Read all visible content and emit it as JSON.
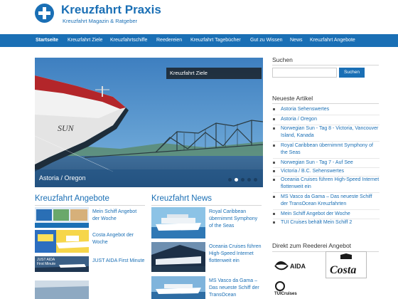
{
  "header": {
    "title": "Kreuzfahrt Praxis",
    "tagline": "Kreuzfahrt Magazin & Ratgeber"
  },
  "nav": {
    "items": [
      "Startseite",
      "Kreuzfahrt Ziele",
      "Kreuzfahrtschiffe",
      "Reedereien",
      "Kreuzfahrt Tagebücher",
      "Gut zu Wissen",
      "News",
      "Kreuzfahrt Angebote"
    ],
    "active_index": 0
  },
  "slider": {
    "tag": "Kreuzfahrt Ziele",
    "caption": "Astoria / Oregon",
    "ship_name": "SUN",
    "dots": 5,
    "active_dot": 1
  },
  "angebote": {
    "title": "Kreuzfahrt Angebote",
    "items": [
      "Mein Schiff Angebot der Woche",
      "Costa Angebot der Woche",
      "JUST AIDA First Minute"
    ],
    "thumb3_text": "JUST AIDA First Minute"
  },
  "news": {
    "title": "Kreuzfahrt News",
    "items": [
      "Royal Caribbean übernimmt Symphony of the Seas",
      "Oceania Cruises führen High-Speed Internet flottenweit ein",
      "MS Vasco da Gama – Das neueste Schiff der TransOcean"
    ]
  },
  "sidebar": {
    "search_title": "Suchen",
    "search_placeholder": "",
    "search_button": "Suchen",
    "articles_title": "Neueste Artikel",
    "articles": [
      "Astoria Sehenswertes",
      "Astoria / Oregon",
      "Norwegian Sun - Tag 8 - Victoria, Vancouver Island, Kanada",
      "Royal Caribbean übernimmt Symphony of the Seas",
      "Norwegian Sun - Tag 7 - Auf See",
      "Victoria / B.C. Sehenswertes",
      "Oceania Cruises führen High-Speed Internet flottenweit ein",
      "MS Vasco da Gama – Das neueste Schiff der TransOcean Kreuzfahrten",
      "Mein Schiff Angebot der Woche",
      "TUI Cruises behält Mein Schiff 2"
    ],
    "direkt_title": "Direkt zum Reederei Angebot",
    "brands": [
      "AIDA",
      "Costa",
      "TUICruises"
    ]
  },
  "colors": {
    "brand": "#1a6fb5",
    "nav_bg": "#1a6fb5"
  }
}
